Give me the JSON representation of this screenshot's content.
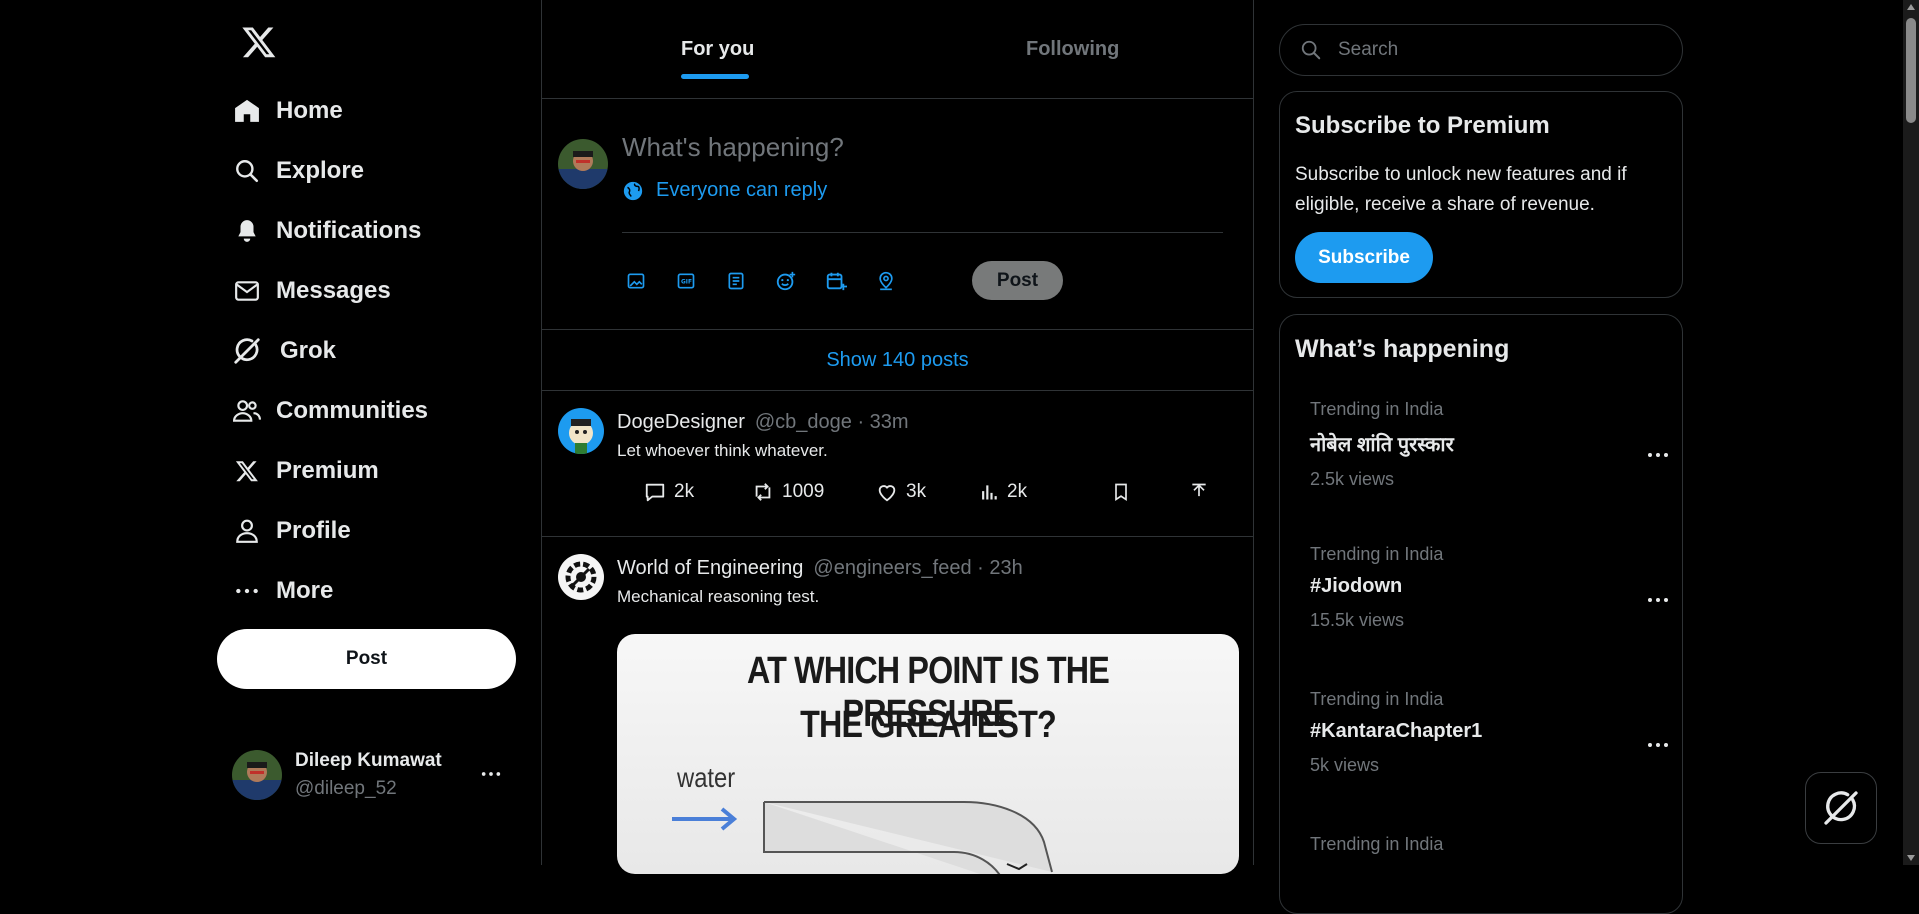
{
  "nav": {
    "items": [
      {
        "label": "Home",
        "icon": "home-icon"
      },
      {
        "label": "Explore",
        "icon": "search-icon"
      },
      {
        "label": "Notifications",
        "icon": "bell-icon"
      },
      {
        "label": "Messages",
        "icon": "mail-icon"
      },
      {
        "label": "Grok",
        "icon": "grok-icon"
      },
      {
        "label": "Communities",
        "icon": "people-icon"
      },
      {
        "label": "Premium",
        "icon": "x-logo-icon"
      },
      {
        "label": "Profile",
        "icon": "person-icon"
      },
      {
        "label": "More",
        "icon": "more-dots-icon"
      }
    ],
    "post_label": "Post",
    "account": {
      "name": "Dileep Kumawat",
      "handle": "@dileep_52"
    }
  },
  "tabs": {
    "for_you": "For you",
    "following": "Following"
  },
  "composer": {
    "placeholder": "What's happening?",
    "reply_setting": "Everyone can reply",
    "post_label": "Post"
  },
  "feed": {
    "show_posts": "Show 140 posts",
    "posts": [
      {
        "name": "DogeDesigner",
        "handle": "@cb_doge · 33m",
        "text": "Let whoever think whatever.",
        "replies": "2k",
        "reposts": "1009",
        "likes": "3k",
        "views": "2k"
      },
      {
        "name": "World of Engineering",
        "handle": "@engineers_feed · 23h",
        "text": "Mechanical reasoning test.",
        "image": {
          "line1": "AT WHICH POINT IS THE PRESSURE",
          "line2": "THE GREATEST?",
          "label": "water"
        }
      }
    ]
  },
  "right": {
    "search_placeholder": "Search",
    "premium": {
      "title": "Subscribe to Premium",
      "desc": "Subscribe to unlock new features and if eligible, receive a share of revenue.",
      "button": "Subscribe"
    },
    "happening": {
      "title": "What’s happening",
      "trends": [
        {
          "context": "Trending in India",
          "name": "नोबेल शांति पुरस्कार",
          "views": "2.5k views"
        },
        {
          "context": "Trending in India",
          "name": "#Jiodown",
          "views": "15.5k views"
        },
        {
          "context": "Trending in India",
          "name": "#KantaraChapter1",
          "views": "5k views"
        },
        {
          "context": "Trending in India",
          "name": "",
          "views": ""
        }
      ]
    }
  },
  "colors": {
    "accent": "#1d9bf0",
    "background": "#000000",
    "border": "#2f3336",
    "muted": "#71767b"
  }
}
